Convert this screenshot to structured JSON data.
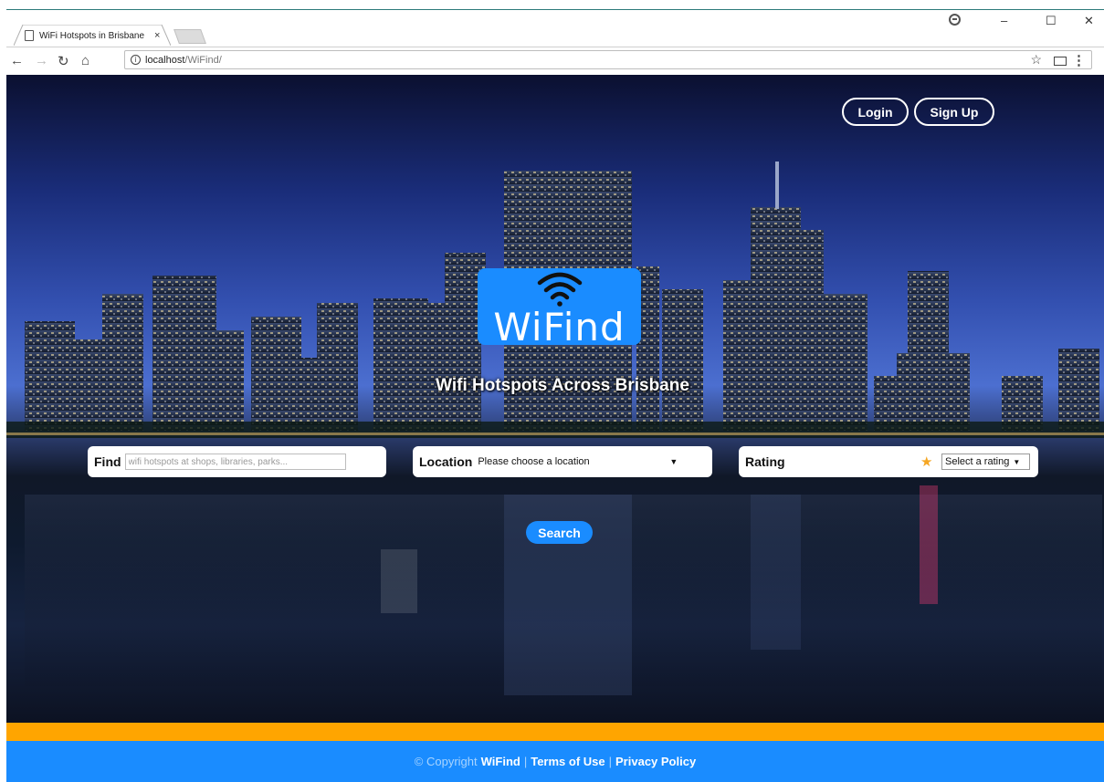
{
  "browser": {
    "tab_title": "WiFi Hotspots in Brisbane",
    "tab_close": "×",
    "url_host": "localhost",
    "url_path": "/WiFind/",
    "window_min": "–",
    "window_max": "☐",
    "window_close": "✕"
  },
  "header": {
    "login_label": "Login",
    "signup_label": "Sign Up"
  },
  "hero": {
    "logo_text": "WiFind",
    "tagline": "Wifi Hotspots Across Brisbane"
  },
  "search": {
    "find_label": "Find",
    "find_placeholder": "wifi hotspots at shops, libraries, parks...",
    "location_label": "Location",
    "location_value": "Please choose a location",
    "rating_label": "Rating",
    "rating_value": "Select a rating",
    "button_label": "Search"
  },
  "footer": {
    "copyright": "© Copyright",
    "brand": "WiFind",
    "separator": "|",
    "terms": "Terms of Use",
    "privacy": "Privacy Policy"
  },
  "colors": {
    "accent": "#1a8cff",
    "footer_stripe": "#ffa500",
    "star": "#f5a623"
  }
}
